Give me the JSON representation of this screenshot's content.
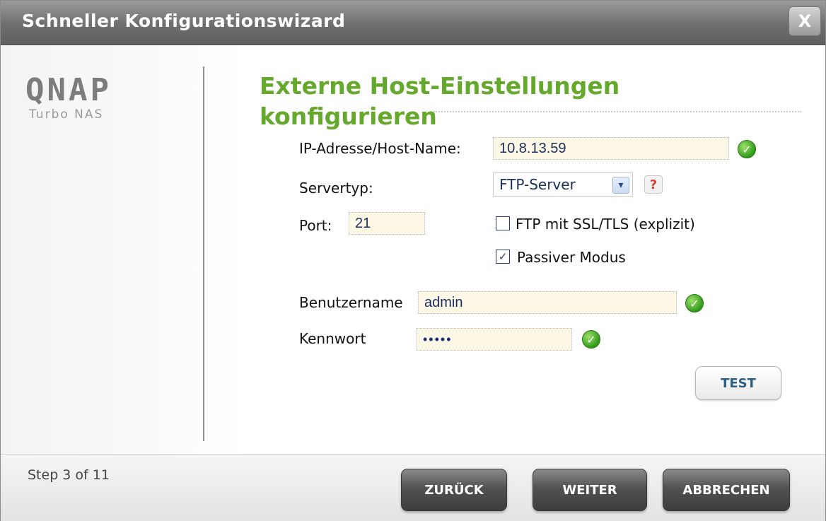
{
  "window": {
    "title": "Schneller Konfigurationswizard",
    "close_glyph": "X"
  },
  "logo": {
    "brand": "QNAP",
    "subtitle": "Turbo NAS"
  },
  "heading": {
    "line1": "Externe Host-Einstellungen",
    "line2": "konfigurieren"
  },
  "form": {
    "ip_label": "IP-Adresse/Host-Name:",
    "ip_value": "10.8.13.59",
    "server_type_label": "Servertyp:",
    "server_type_value": "FTP-Server",
    "help_glyph": "?",
    "port_label": "Port:",
    "port_value": "21",
    "ssl_label": "FTP mit SSL/TLS (explizit)",
    "ssl_checked": false,
    "passive_label": "Passiver Modus",
    "passive_checked": true,
    "username_label": "Benutzername",
    "username_value": "admin",
    "password_label": "Kennwort",
    "password_value": "•••••",
    "test_button": "TEST"
  },
  "footer": {
    "step": "Step 3 of 11",
    "back": "ZURÜCK",
    "next": "WEITER",
    "cancel": "ABBRECHEN"
  },
  "icons": {
    "ok": "check-circle-icon",
    "help": "help-icon",
    "dropdown": "chevron-down-icon"
  }
}
